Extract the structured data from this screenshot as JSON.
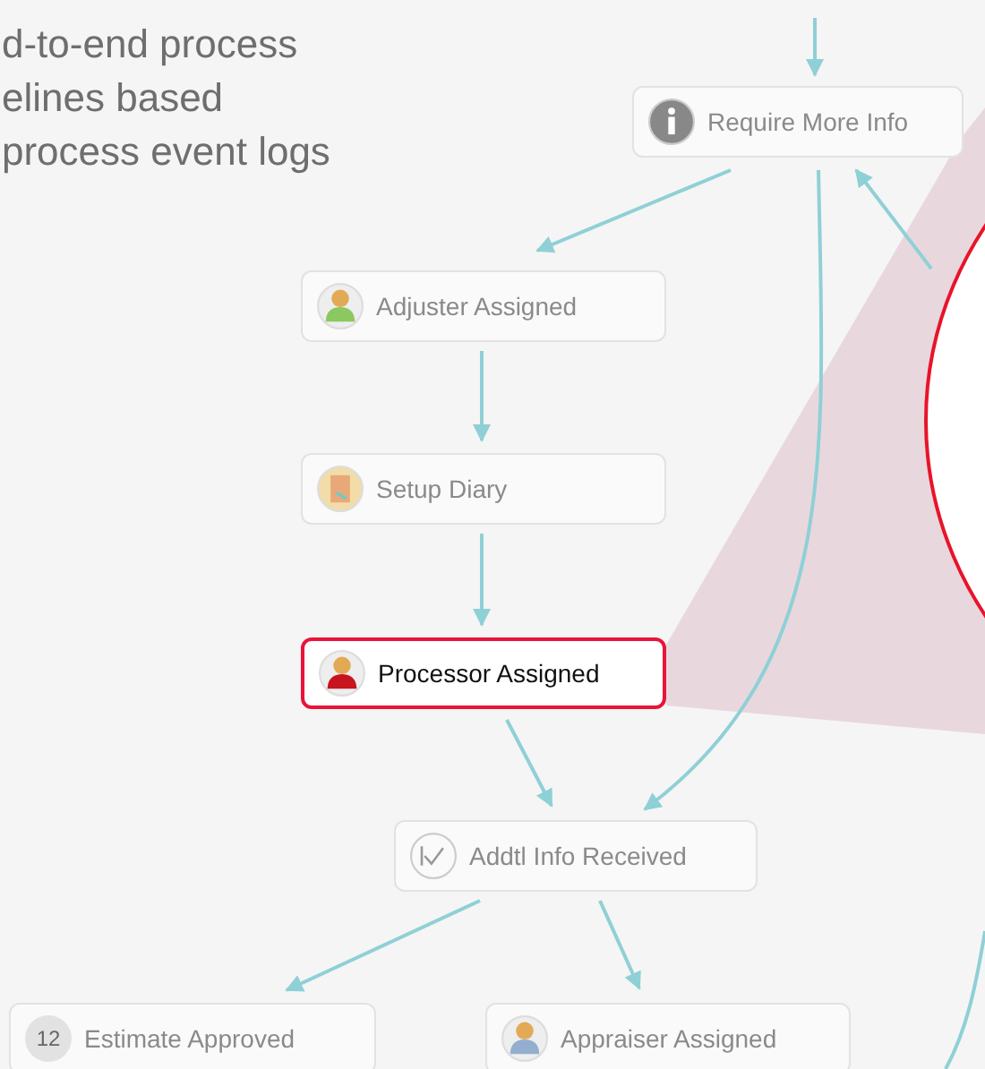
{
  "intro": {
    "lines": [
      "d-to-end process",
      "elines based",
      "process event logs"
    ]
  },
  "nodes": [
    {
      "label": "Require More Info",
      "kind": "info",
      "selected": false
    },
    {
      "label": "Adjuster Assigned",
      "kind": "person",
      "color": "#8cc860",
      "selected": false
    },
    {
      "label": "Setup Diary",
      "kind": "diary",
      "selected": false
    },
    {
      "label": "Processor Assigned",
      "kind": "person",
      "color": "#c8141e",
      "selected": true
    },
    {
      "label": "Addtl Info Received",
      "kind": "check",
      "selected": false
    },
    {
      "label": "Estimate Approved",
      "kind": "number",
      "badge": "12",
      "selected": false
    },
    {
      "label": "Appraiser Assigned",
      "kind": "person",
      "color": "#94aed0",
      "selected": false
    }
  ]
}
